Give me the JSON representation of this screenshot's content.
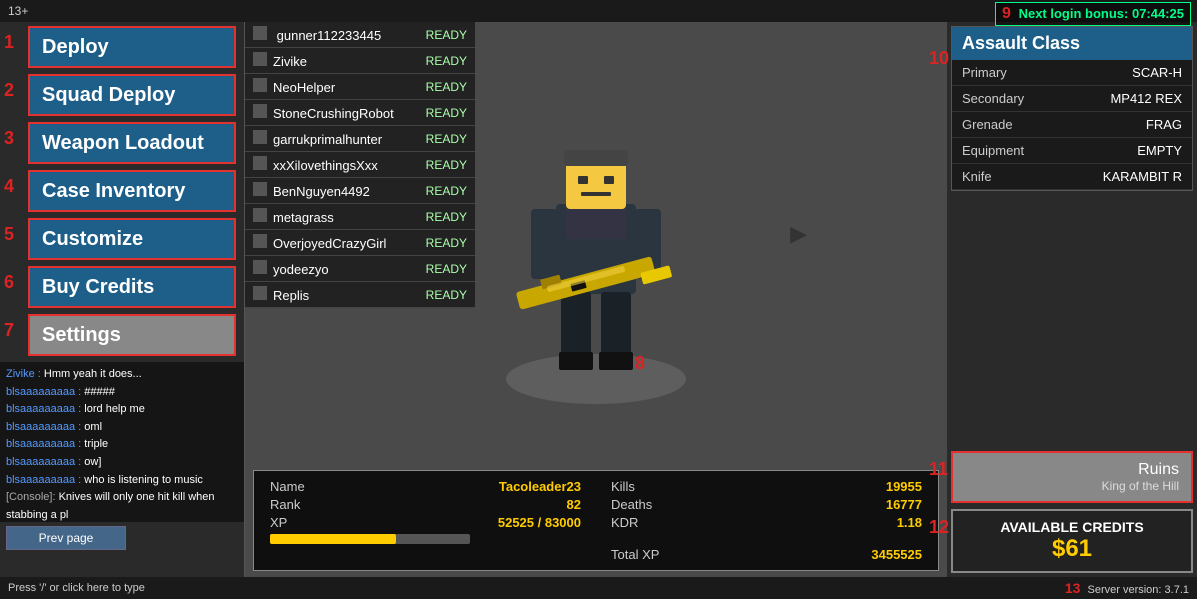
{
  "topbar": {
    "age_label": "13+"
  },
  "sidebar": {
    "buttons": [
      {
        "id": "deploy",
        "label": "Deploy",
        "number": "1"
      },
      {
        "id": "squad-deploy",
        "label": "Squad Deploy",
        "number": "2"
      },
      {
        "id": "weapon-loadout",
        "label": "Weapon Loadout",
        "number": "3"
      },
      {
        "id": "case-inventory",
        "label": "Case Inventory",
        "number": "4"
      },
      {
        "id": "customize",
        "label": "Customize",
        "number": "5"
      },
      {
        "id": "buy-credits",
        "label": "Buy Credits",
        "number": "6"
      },
      {
        "id": "settings",
        "label": "Settings",
        "number": "7"
      }
    ]
  },
  "squad": {
    "members": [
      {
        "name": "gunner112233445",
        "status": "READY"
      },
      {
        "name": "Zivike",
        "status": "READY"
      },
      {
        "name": "NeoHelper",
        "status": "READY"
      },
      {
        "name": "StoneCrushingRobot",
        "status": "READY"
      },
      {
        "name": "garrukprimalhunter",
        "status": "READY"
      },
      {
        "name": "xxXilovethingsXxx",
        "status": "READY"
      },
      {
        "name": "BenNguyen4492",
        "status": "READY"
      },
      {
        "name": "metagrass",
        "status": "READY"
      },
      {
        "name": "OverjoyedCrazyGirl",
        "status": "READY"
      },
      {
        "name": "yodeezyo",
        "status": "READY"
      },
      {
        "name": "Replis",
        "status": "READY"
      }
    ]
  },
  "player_stats": {
    "name_label": "Name",
    "name_value": "Tacoleader23",
    "rank_label": "Rank",
    "rank_value": "82",
    "xp_label": "XP",
    "xp_value": "52525 / 83000",
    "kills_label": "Kills",
    "kills_value": "19955",
    "deaths_label": "Deaths",
    "deaths_value": "16777",
    "kdr_label": "KDR",
    "kdr_value": "1.18",
    "total_xp_label": "Total XP",
    "total_xp_value": "3455525",
    "xp_percent": 63
  },
  "assault_class": {
    "title": "Assault Class",
    "number": "10",
    "rows": [
      {
        "label": "Primary",
        "value": "SCAR-H"
      },
      {
        "label": "Secondary",
        "value": "MP412 REX"
      },
      {
        "label": "Grenade",
        "value": "FRAG"
      },
      {
        "label": "Equipment",
        "value": "EMPTY"
      },
      {
        "label": "Knife",
        "value": "KARAMBIT R"
      }
    ]
  },
  "ruins": {
    "number": "11",
    "title": "Ruins",
    "subtitle": "King of the Hill"
  },
  "credits": {
    "number": "12",
    "label": "AVAILABLE CREDITS",
    "value": "$61"
  },
  "login_bonus": {
    "number": "9",
    "text": "Next login bonus: 07:44:25"
  },
  "chat": {
    "messages": [
      {
        "name": "Zivike",
        "text": "Hmm yeah it does..."
      },
      {
        "name": "blsaaaaaaaaa",
        "text": "#####"
      },
      {
        "name": "blsaaaaaaaaa",
        "text": "lord help me"
      },
      {
        "name": "blsaaaaaaaaa",
        "text": "oml"
      },
      {
        "name": "blsaaaaaaaaa",
        "text": "triple"
      },
      {
        "name": "blsaaaaaaaaa",
        "text": "ow]"
      },
      {
        "name": "blsaaaaaaaaa",
        "text": "who is listening to music"
      },
      {
        "name": "[Console]",
        "text": "Knives will only one hit kill when stabbing a pl"
      }
    ],
    "prev_page": "Prev page"
  },
  "bottom_bar": {
    "prompt": "Press '/' or click here to type",
    "number": "13",
    "server_version": "Server version: 3.7.1"
  },
  "numbers": {
    "squad_number": "8"
  }
}
